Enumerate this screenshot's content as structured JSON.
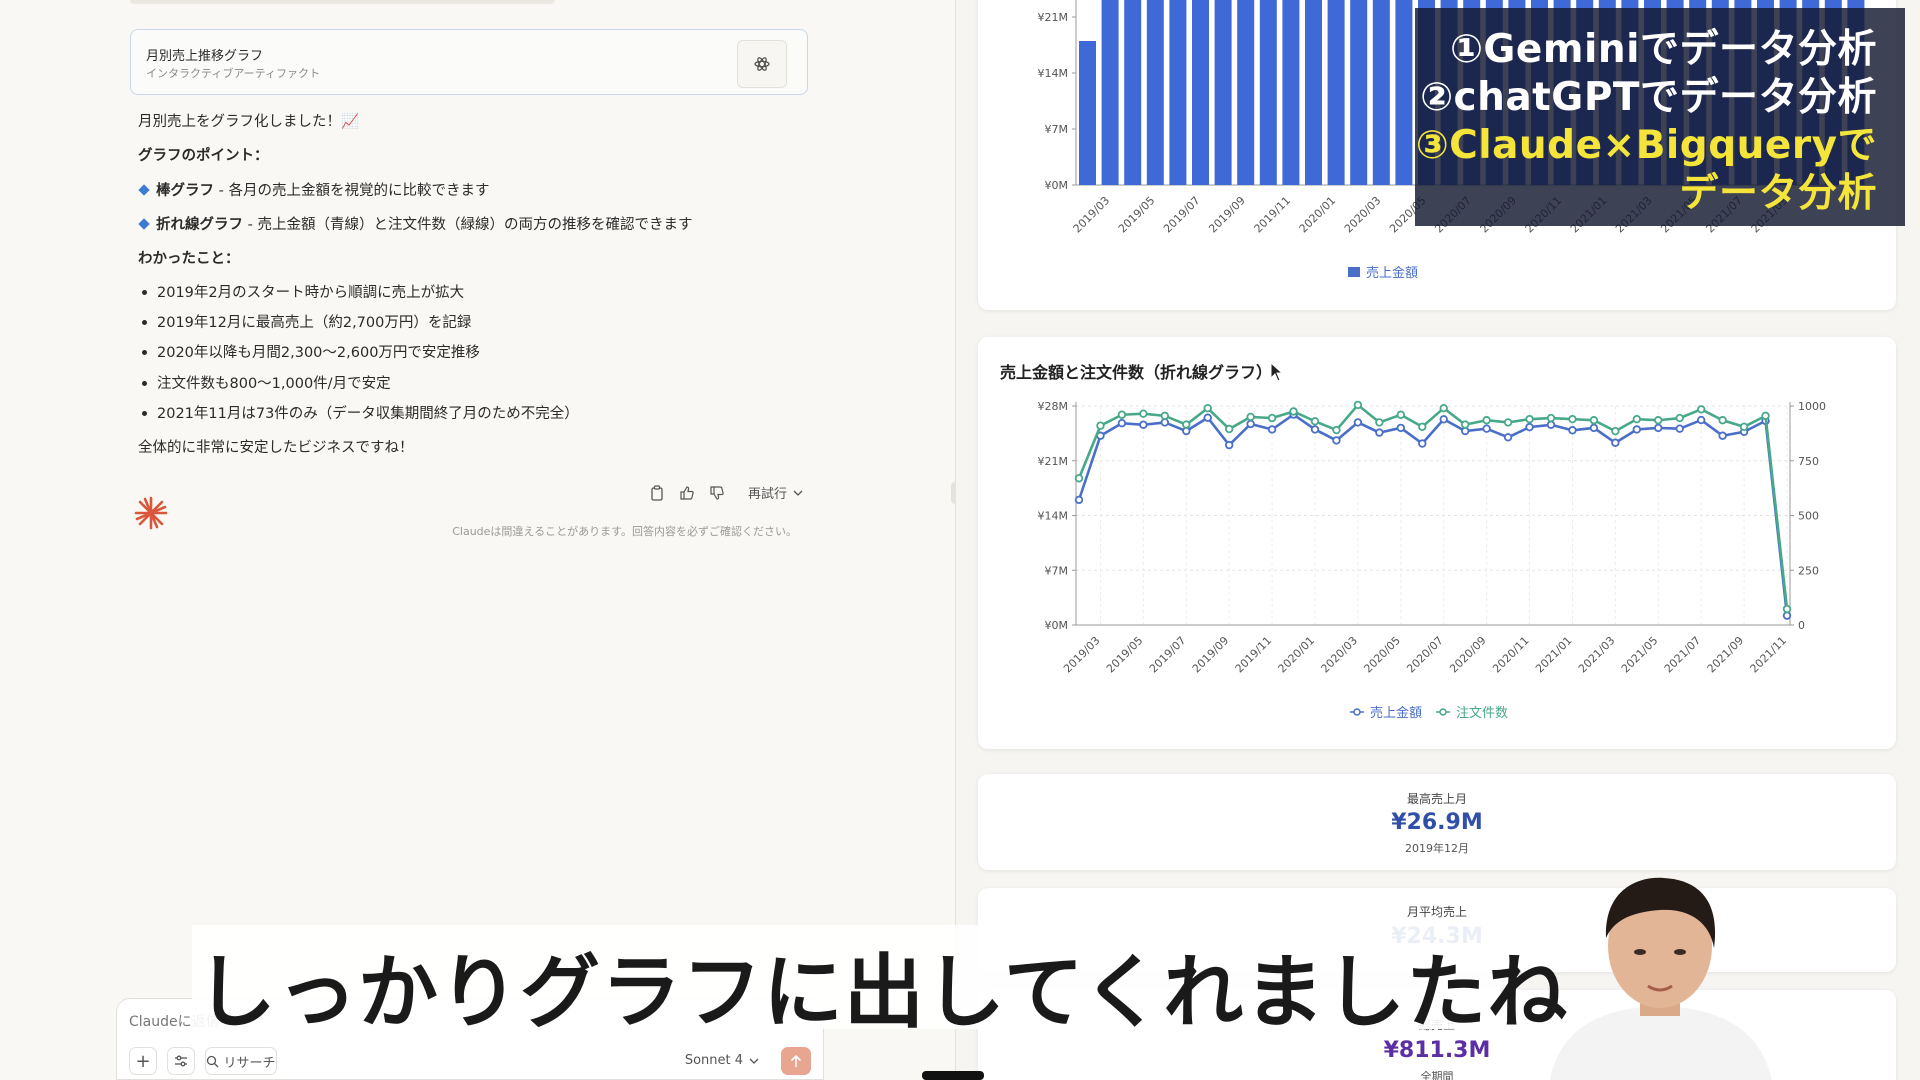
{
  "artifact": {
    "title": "月別売上推移グラフ",
    "subtitle": "インタラクティブアーティファクト",
    "icon": "artifact-icon"
  },
  "message": {
    "intro": "月別売上をグラフ化しました！📈",
    "points_heading": "グラフのポイント：",
    "point1_bold": "棒グラフ",
    "point1_rest": " - 各月の売上金額を視覚的に比較できます",
    "point2_bold": "折れ線グラフ",
    "point2_rest": " - 売上金額（青線）と注文件数（緑線）の両方の推移を確認できます",
    "findings_heading": "わかったこと：",
    "findings": [
      "2019年2月のスタート時から順調に売上が拡大",
      "2019年12月に最高売上（約2,700万円）を記録",
      "2020年以降も月間2,300〜2,600万円で安定推移",
      "注文件数も800〜1,000件/月で安定",
      "2021年11月は73件のみ（データ収集期間終了月のため不完全）"
    ],
    "closing": "全体的に非常に安定したビジネスですね！",
    "retry_label": "再試行",
    "disclaimer": "Claudeは間違えることがあります。回答内容を必ずご確認ください。"
  },
  "composer": {
    "placeholder": "Claudeに返信",
    "research_label": "リサーチ",
    "model": "Sonnet 4"
  },
  "bar_chart_legend": "売上金額",
  "line_chart": {
    "title": "売上金額と注文件数（折れ線グラフ）",
    "legend_sales": "売上金額",
    "legend_orders": "注文件数"
  },
  "stats": {
    "max": {
      "label": "最高売上月",
      "value": "¥26.9M",
      "date": "2019年12月"
    },
    "avg": {
      "label": "月平均売上",
      "value": "¥24.3M"
    },
    "total": {
      "label": "総売上",
      "value": "¥811.3M",
      "date": "全期間"
    }
  },
  "overlay": {
    "line1": "①Geminiでデータ分析",
    "line2": "②chatGPTでデータ分析",
    "line3": "③Claude×Bigqueryで",
    "line4": "データ分析"
  },
  "subtitle": "しっかりグラフに出してくれましたね",
  "colors": {
    "sales": "#4a6fc9",
    "orders": "#47a88a",
    "bar": "#3f69d6",
    "stat_blue": "#2f4fa8",
    "stat_purple": "#5b2ea6",
    "overlay_highlight": "#f5e53a"
  },
  "chart_data": [
    {
      "type": "bar",
      "series": [
        {
          "name": "売上金額",
          "values": [
            18,
            26,
            26,
            26,
            26,
            26,
            26,
            26,
            26,
            24,
            26,
            26,
            26,
            26,
            26,
            26,
            26,
            26,
            26,
            26,
            26,
            26,
            26,
            26,
            26,
            26,
            26,
            26,
            26,
            26,
            26,
            26,
            26,
            26,
            26
          ]
        }
      ],
      "yticks": [
        "¥0M",
        "¥7M",
        "¥14M",
        "¥21M"
      ],
      "xticks": [
        "2019/03",
        "2019/05",
        "2019/07",
        "2019/09",
        "2019/11",
        "2020/01",
        "2020/03",
        "2020/05",
        "2020/07",
        "2020/09",
        "2020/11",
        "2021/01",
        "2021/03",
        "2021/05",
        "2021/07",
        "2021/09"
      ]
    },
    {
      "type": "line",
      "x": [
        "2019/02",
        "2019/03",
        "2019/04",
        "2019/05",
        "2019/06",
        "2019/07",
        "2019/08",
        "2019/09",
        "2019/10",
        "2019/11",
        "2019/12",
        "2020/01",
        "2020/02",
        "2020/03",
        "2020/04",
        "2020/05",
        "2020/06",
        "2020/07",
        "2020/08",
        "2020/09",
        "2020/10",
        "2020/11",
        "2020/12",
        "2021/01",
        "2021/02",
        "2021/03",
        "2021/04",
        "2021/05",
        "2021/06",
        "2021/07",
        "2021/08",
        "2021/09",
        "2021/10",
        "2021/11"
      ],
      "series": [
        {
          "name": "売上金額",
          "axis": "left",
          "values": [
            16,
            24.2,
            25.8,
            25.6,
            25.9,
            24.8,
            26.5,
            23,
            25.7,
            25,
            26.9,
            25,
            23.6,
            25.9,
            24.6,
            25.2,
            23.2,
            26.3,
            24.8,
            25.1,
            24,
            25.3,
            25.6,
            24.9,
            25.2,
            23.3,
            25,
            25.2,
            25.1,
            26.2,
            24.2,
            24.7,
            26.1,
            1.2
          ]
        },
        {
          "name": "注文件数",
          "axis": "right",
          "values": [
            670,
            910,
            960,
            965,
            955,
            915,
            990,
            895,
            950,
            945,
            975,
            930,
            890,
            1005,
            925,
            960,
            905,
            990,
            915,
            935,
            925,
            940,
            945,
            940,
            935,
            885,
            940,
            935,
            945,
            985,
            935,
            905,
            955,
            73
          ]
        }
      ],
      "y_left_ticks": [
        "¥0M",
        "¥7M",
        "¥14M",
        "¥21M",
        "¥28M"
      ],
      "y_right_ticks": [
        "0",
        "250",
        "500",
        "750",
        "1000"
      ],
      "ylim_left": [
        0,
        28
      ],
      "ylim_right": [
        0,
        1000
      ],
      "xticks": [
        "2019/03",
        "2019/05",
        "2019/07",
        "2019/09",
        "2019/11",
        "2020/01",
        "2020/03",
        "2020/05",
        "2020/07",
        "2020/09",
        "2020/11",
        "2021/01",
        "2021/03",
        "2021/05",
        "2021/07",
        "2021/09",
        "2021/11"
      ]
    }
  ]
}
